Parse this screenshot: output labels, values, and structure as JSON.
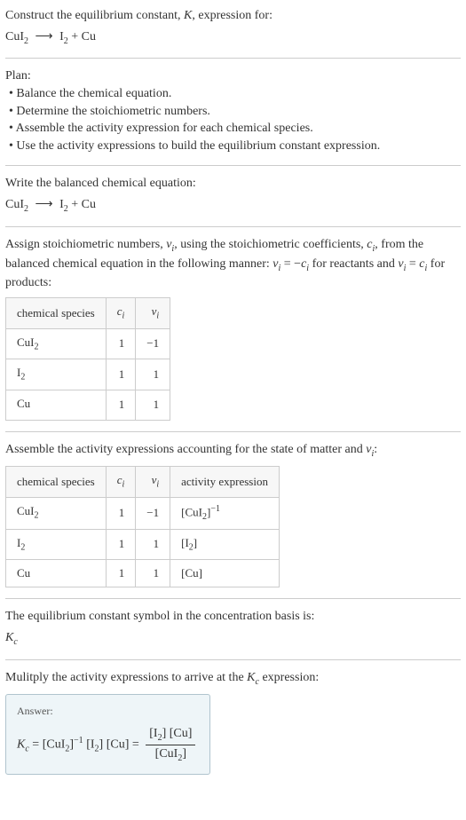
{
  "intro": {
    "line1_prefix": "Construct the equilibrium constant, ",
    "K": "K",
    "line1_suffix": ", expression for:",
    "eq_lhs": "CuI",
    "eq_lhs_sub": "2",
    "arrow": "⟶",
    "eq_rhs_a": "I",
    "eq_rhs_a_sub": "2",
    "plus": " + ",
    "eq_rhs_b": "Cu"
  },
  "plan": {
    "title": "Plan:",
    "b1": "• Balance the chemical equation.",
    "b2": "• Determine the stoichiometric numbers.",
    "b3": "• Assemble the activity expression for each chemical species.",
    "b4": "• Use the activity expressions to build the equilibrium constant expression."
  },
  "balanced": {
    "title": "Write the balanced chemical equation:"
  },
  "stoich": {
    "p1_a": "Assign stoichiometric numbers, ",
    "nu": "ν",
    "sub_i": "i",
    "p1_b": ", using the stoichiometric coefficients, ",
    "c": "c",
    "p1_c": ", from the balanced chemical equation in the following manner: ",
    "eq1": "ν",
    "eq1_b": " = −",
    "eq1_c": "c",
    "p1_d": " for reactants and ",
    "eq2": "ν",
    "eq2_b": " = ",
    "eq2_c": "c",
    "p1_e": " for products:",
    "headers": {
      "h1": "chemical species",
      "h2": "c",
      "h3": "ν"
    },
    "rows": [
      {
        "s": "CuI",
        "s_sub": "2",
        "c": "1",
        "v": "−1"
      },
      {
        "s": "I",
        "s_sub": "2",
        "c": "1",
        "v": "1"
      },
      {
        "s": "Cu",
        "s_sub": "",
        "c": "1",
        "v": "1"
      }
    ]
  },
  "activity": {
    "p1_a": "Assemble the activity expressions accounting for the state of matter and ",
    "p1_b": ":",
    "headers": {
      "h1": "chemical species",
      "h2": "c",
      "h3": "ν",
      "h4": "activity expression"
    },
    "rows": [
      {
        "s": "CuI",
        "s_sub": "2",
        "c": "1",
        "v": "−1",
        "a_l": "[CuI",
        "a_sub": "2",
        "a_r": "]",
        "a_exp": "−1"
      },
      {
        "s": "I",
        "s_sub": "2",
        "c": "1",
        "v": "1",
        "a_l": "[I",
        "a_sub": "2",
        "a_r": "]",
        "a_exp": ""
      },
      {
        "s": "Cu",
        "s_sub": "",
        "c": "1",
        "v": "1",
        "a_l": "[Cu",
        "a_sub": "",
        "a_r": "]",
        "a_exp": ""
      }
    ]
  },
  "symbol": {
    "p": "The equilibrium constant symbol in the concentration basis is:",
    "K": "K",
    "Ksub": "c"
  },
  "multiply": {
    "p_a": "Mulitply the activity expressions to arrive at the ",
    "K": "K",
    "Ksub": "c",
    "p_b": " expression:"
  },
  "answer": {
    "label": "Answer:",
    "lhs_K": "K",
    "lhs_Ksub": "c",
    "eq": " = ",
    "t1_l": "[CuI",
    "t1_sub": "2",
    "t1_r": "]",
    "t1_exp": "−1",
    "sp": " ",
    "t2_l": "[I",
    "t2_sub": "2",
    "t2_r": "]",
    "t3": "[Cu]",
    "num_a": "[I",
    "num_a_sub": "2",
    "num_a_r": "] ",
    "num_b": "[Cu]",
    "den_a": "[CuI",
    "den_a_sub": "2",
    "den_a_r": "]"
  }
}
